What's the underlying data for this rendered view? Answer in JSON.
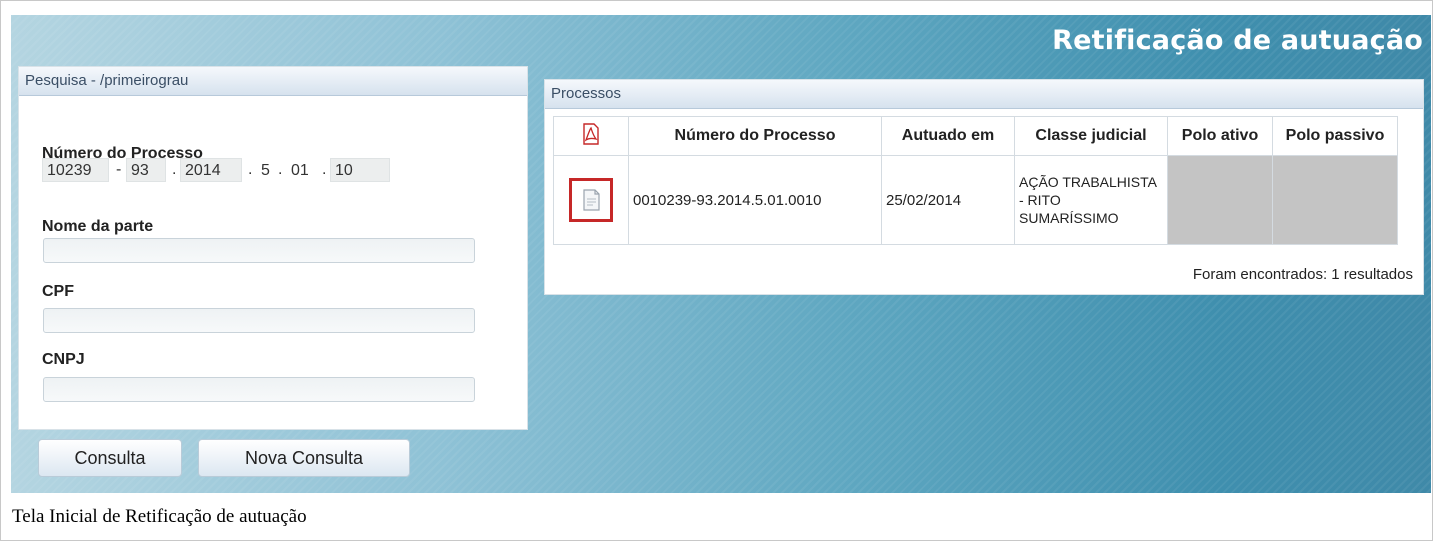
{
  "page": {
    "title": "Retificação de autuação",
    "caption": "Tela Inicial de Retificação de autuação"
  },
  "search": {
    "header": "Pesquisa - /primeirograu",
    "numero_label": "Número do Processo",
    "numero": {
      "seq": "10239",
      "digito": "93",
      "ano": "2014",
      "segmento": "5",
      "tribunal": "01",
      "origem": "10",
      "sep_dash": "-",
      "sep_dot": "."
    },
    "nome_label": "Nome da parte",
    "nome_value": "",
    "cpf_label": "CPF",
    "cpf_value": "",
    "cnpj_label": "CNPJ",
    "cnpj_value": ""
  },
  "buttons": {
    "consulta": "Consulta",
    "nova_consulta": "Nova Consulta"
  },
  "results": {
    "header": "Processos",
    "columns": [
      "Número do Processo",
      "Autuado em",
      "Classe judicial",
      "Polo ativo",
      "Polo passivo"
    ],
    "rows": [
      {
        "numero": "0010239-93.2014.5.01.0010",
        "autuado": "25/02/2014",
        "classe": "AÇÃO TRABALHISTA - RITO SUMARÍSSIMO",
        "polo_ativo": "",
        "polo_passivo": ""
      }
    ],
    "footer": "Foram encontrados: 1 resultados"
  },
  "icons": {
    "pdf": "pdf-icon",
    "document": "document-icon"
  },
  "colors": {
    "highlight": "#c62828",
    "header_text": "#3a4e65"
  }
}
